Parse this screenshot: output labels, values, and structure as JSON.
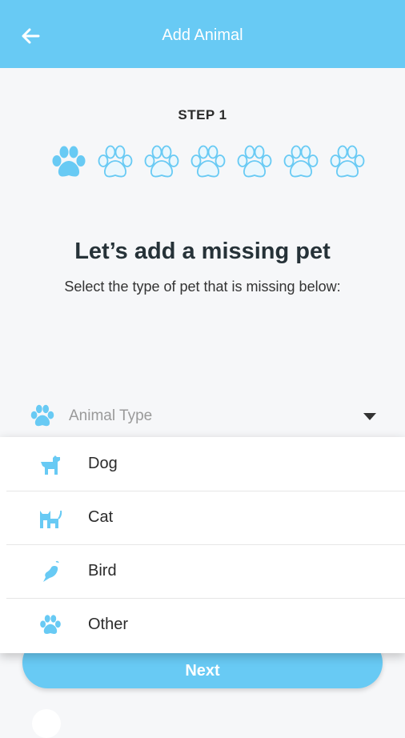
{
  "header": {
    "title": "Add Animal",
    "back_icon": "arrow-left-icon"
  },
  "stepper": {
    "label": "STEP 1",
    "current": 1,
    "total": 7,
    "step_icon": "paw-icon"
  },
  "headline": "Let’s add a missing pet",
  "subline": "Select the type of pet that is missing below:",
  "select": {
    "placeholder": "Animal Type",
    "icon": "paw-icon",
    "caret_icon": "caret-down-icon"
  },
  "options": [
    {
      "label": "Dog",
      "icon": "dog-icon"
    },
    {
      "label": "Cat",
      "icon": "cat-icon"
    },
    {
      "label": "Bird",
      "icon": "bird-icon"
    },
    {
      "label": "Other",
      "icon": "paw-icon"
    }
  ],
  "next_button": {
    "label": "Next"
  },
  "colors": {
    "accent": "#68caf4",
    "accent_light": "#d8f0fc",
    "background": "#f6f7f9"
  }
}
